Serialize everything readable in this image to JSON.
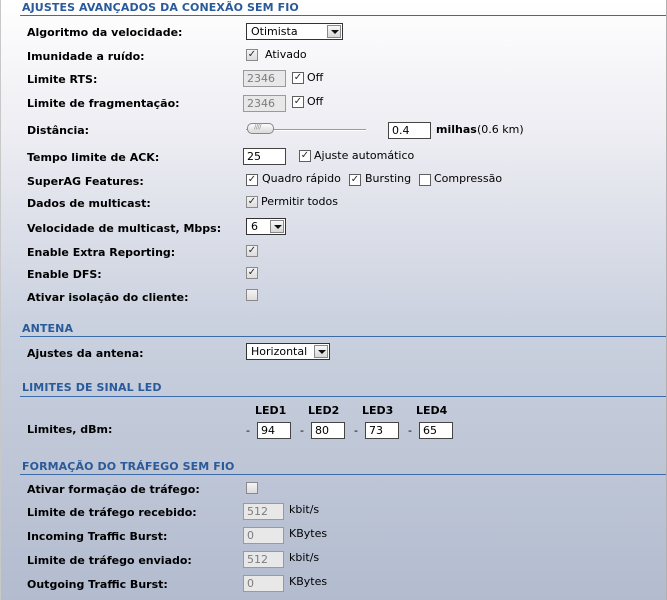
{
  "sections": {
    "advanced": "AJUSTES AVANÇADOS DA CONEXÃO SEM FIO",
    "antenna": "ANTENA",
    "led": "LIMITES DE SINAL LED",
    "traffic": "FORMAÇÃO DO TRÁFEGO SEM FIO"
  },
  "advanced": {
    "speed_algo_label": "Algoritmo da velocidade:",
    "speed_algo_value": "Otimista",
    "noise_label": "Imunidade a ruído:",
    "noise_checked": true,
    "noise_text": "Ativado",
    "rts_label": "Limite RTS:",
    "rts_value": "2346",
    "rts_off_checked": true,
    "rts_off_text": "Off",
    "frag_label": "Limite de fragmentação:",
    "frag_value": "2346",
    "frag_off_checked": true,
    "frag_off_text": "Off",
    "distance_label": "Distância:",
    "distance_value": "0.4",
    "distance_unit": "milhas",
    "distance_km": "(0.6 km)",
    "distance_slider_fraction": 0.0,
    "ack_label": "Tempo limite de ACK:",
    "ack_value": "25",
    "ack_auto_checked": true,
    "ack_auto_text": "Ajuste automático",
    "superag_label": "SuperAG Features:",
    "superag_fast_checked": true,
    "superag_fast_text": "Quadro rápido",
    "superag_burst_checked": true,
    "superag_burst_text": "Bursting",
    "superag_comp_checked": false,
    "superag_comp_text": "Compressão",
    "multicast_label": "Dados de multicast:",
    "multicast_checked": true,
    "multicast_text": "Permitir todos",
    "mcast_rate_label": "Velocidade de multicast, Mbps:",
    "mcast_rate_value": "6",
    "extra_reporting_label": "Enable Extra Reporting:",
    "extra_reporting_checked": true,
    "dfs_label": "Enable DFS:",
    "dfs_checked": true,
    "isolation_label": "Ativar isolação do cliente:",
    "isolation_checked": false
  },
  "antenna": {
    "settings_label": "Ajustes da antena:",
    "settings_value": "Horizontal"
  },
  "led": {
    "label": "Limites, dBm:",
    "headers": [
      "LED1",
      "LED2",
      "LED3",
      "LED4"
    ],
    "dash": "-",
    "values": [
      "94",
      "80",
      "73",
      "65"
    ]
  },
  "traffic": {
    "enable_label": "Ativar formação de tráfego:",
    "enable_checked": false,
    "rx_limit_label": "Limite de tráfego recebido:",
    "rx_limit_value": "512",
    "rx_limit_unit": "kbit/s",
    "in_burst_label": "Incoming Traffic Burst:",
    "in_burst_value": "0",
    "in_burst_unit": "KBytes",
    "tx_limit_label": "Limite de tráfego enviado:",
    "tx_limit_value": "512",
    "tx_limit_unit": "kbit/s",
    "out_burst_label": "Outgoing Traffic Burst:",
    "out_burst_value": "0",
    "out_burst_unit": "KBytes"
  }
}
